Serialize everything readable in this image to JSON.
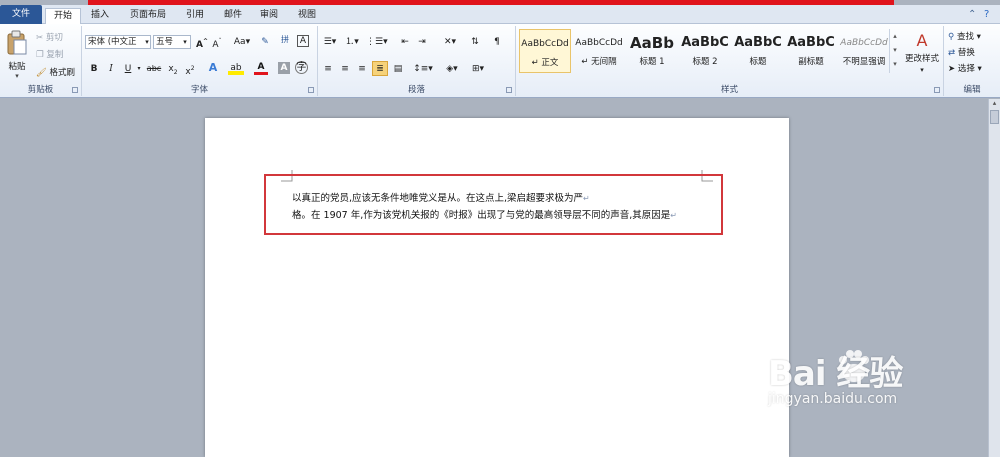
{
  "tabs": {
    "file": "文件",
    "items": [
      "开始",
      "插入",
      "页面布局",
      "引用",
      "邮件",
      "审阅",
      "视图"
    ]
  },
  "clipboard": {
    "label": "剪贴板",
    "paste": "粘贴",
    "cut": "剪切",
    "copy": "复制",
    "format_painter": "格式刷"
  },
  "font": {
    "label": "字体",
    "family": "宋体 (中文正",
    "size": "五号"
  },
  "paragraph": {
    "label": "段落"
  },
  "styles": {
    "label": "样式",
    "items": [
      {
        "preview": "AaBbCcDd",
        "name": "正文"
      },
      {
        "preview": "AaBbCcDd",
        "name": "无间隔"
      },
      {
        "preview": "AaBb",
        "name": "标题 1"
      },
      {
        "preview": "AaBbC",
        "name": "标题 2"
      },
      {
        "preview": "AaBbC",
        "name": "标题"
      },
      {
        "preview": "AaBbC",
        "name": "副标题"
      },
      {
        "preview": "AaBbCcDd",
        "name": "不明显强调"
      }
    ],
    "change": "更改样式"
  },
  "editing": {
    "label": "编辑",
    "find": "查找",
    "replace": "替换",
    "select": "选择"
  },
  "document": {
    "line1": "以真正的党员,应该无条件地唯党义是从。在这点上,梁启超要求极为严",
    "line2": "格。在 1907 年,作为该党机关报的《时报》出现了与党的最高领导层不同的声音,其原因是",
    "para_mark": "↵"
  },
  "watermark": {
    "logo": "Bai  经验",
    "url": "jingyan.baidu.com"
  },
  "colors": {
    "highlight_box": "#d2373b",
    "file_tab": "#2b5797"
  }
}
